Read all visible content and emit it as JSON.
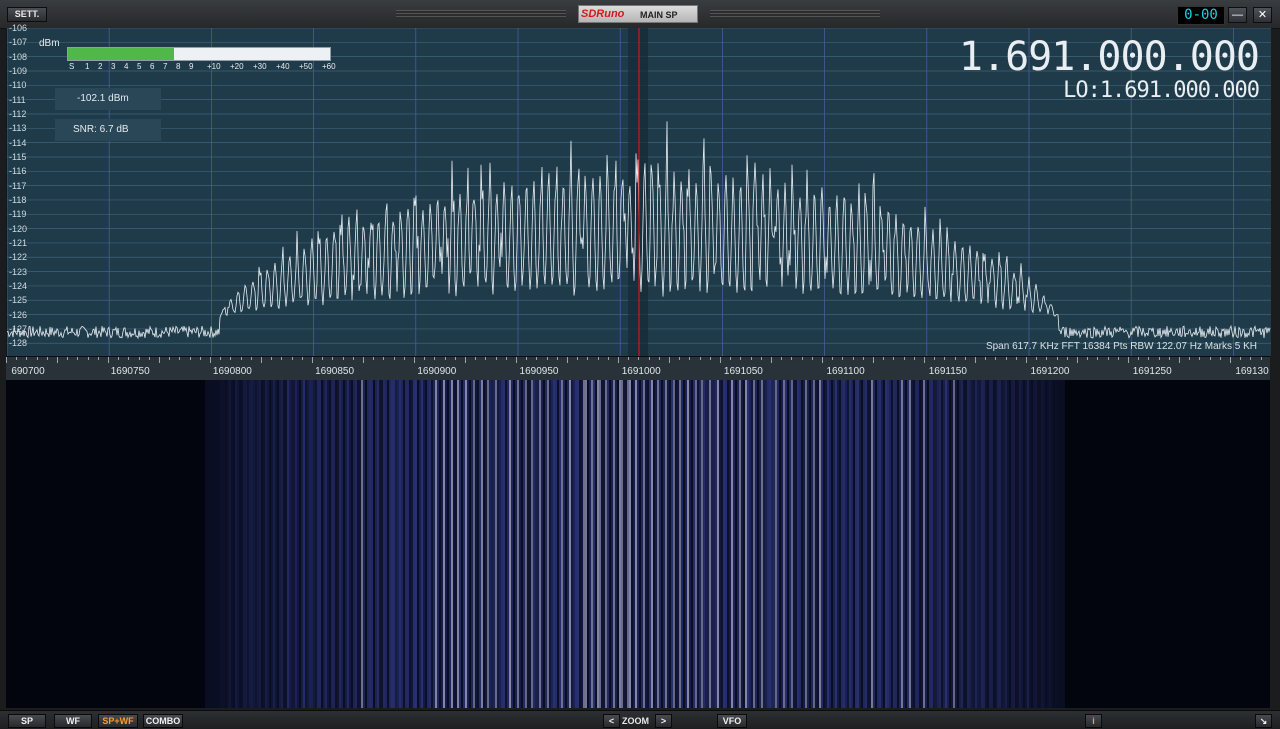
{
  "toolbar": {
    "settings_label": "SETT.",
    "brand": "SDRuno",
    "mode": "MAIN SP",
    "clock": "0-00",
    "minimize_label": "—",
    "close_label": "✕"
  },
  "spectrum": {
    "dbm_unit": "dBm",
    "level_readout": "-102.1 dBm",
    "snr_readout": "SNR: 6.7 dB",
    "frequency": "1.691.000.000",
    "lo_frequency": "LO:1.691.000.000",
    "info_line": "Span 617.7 KHz   FFT 16384 Pts   RBW 122.07 Hz   Marks 5 KH",
    "smeter_level": 0.405,
    "smeter_scale": [
      "S",
      "1",
      "2",
      "3",
      "4",
      "5",
      "6",
      "7",
      "8",
      "9",
      "+10",
      "+20",
      "+30",
      "+40",
      "+50",
      "+60"
    ],
    "y_ticks": [
      "-106",
      "-107",
      "-108",
      "-109",
      "-110",
      "-111",
      "-112",
      "-113",
      "-114",
      "-115",
      "-116",
      "-117",
      "-118",
      "-119",
      "-120",
      "-121",
      "-122",
      "-123",
      "-124",
      "-125",
      "-126",
      "-127",
      "-128"
    ],
    "x_ticks": [
      "690700",
      "1690750",
      "1690800",
      "1690850",
      "1690900",
      "1690950",
      "1691000",
      "1691050",
      "1691100",
      "1691150",
      "1691200",
      "1691250",
      "169130"
    ]
  },
  "bottombar": {
    "sp_label": "SP",
    "wf_label": "WF",
    "spwf_label": "SP+WF",
    "combo_label": "COMBO",
    "zoom_prev_label": "<",
    "zoom_label": "ZOOM",
    "zoom_next_label": ">",
    "vfo_label": "VFO",
    "info_label": "i",
    "resize_label": "↘"
  },
  "colors": {
    "spectrum_bg": "#1f3b4a",
    "smeter_fill": "#4fb848",
    "center_marker": "#d01818",
    "waterfall_signal": "#5060e0",
    "active_button": "#ff9a2e"
  }
}
